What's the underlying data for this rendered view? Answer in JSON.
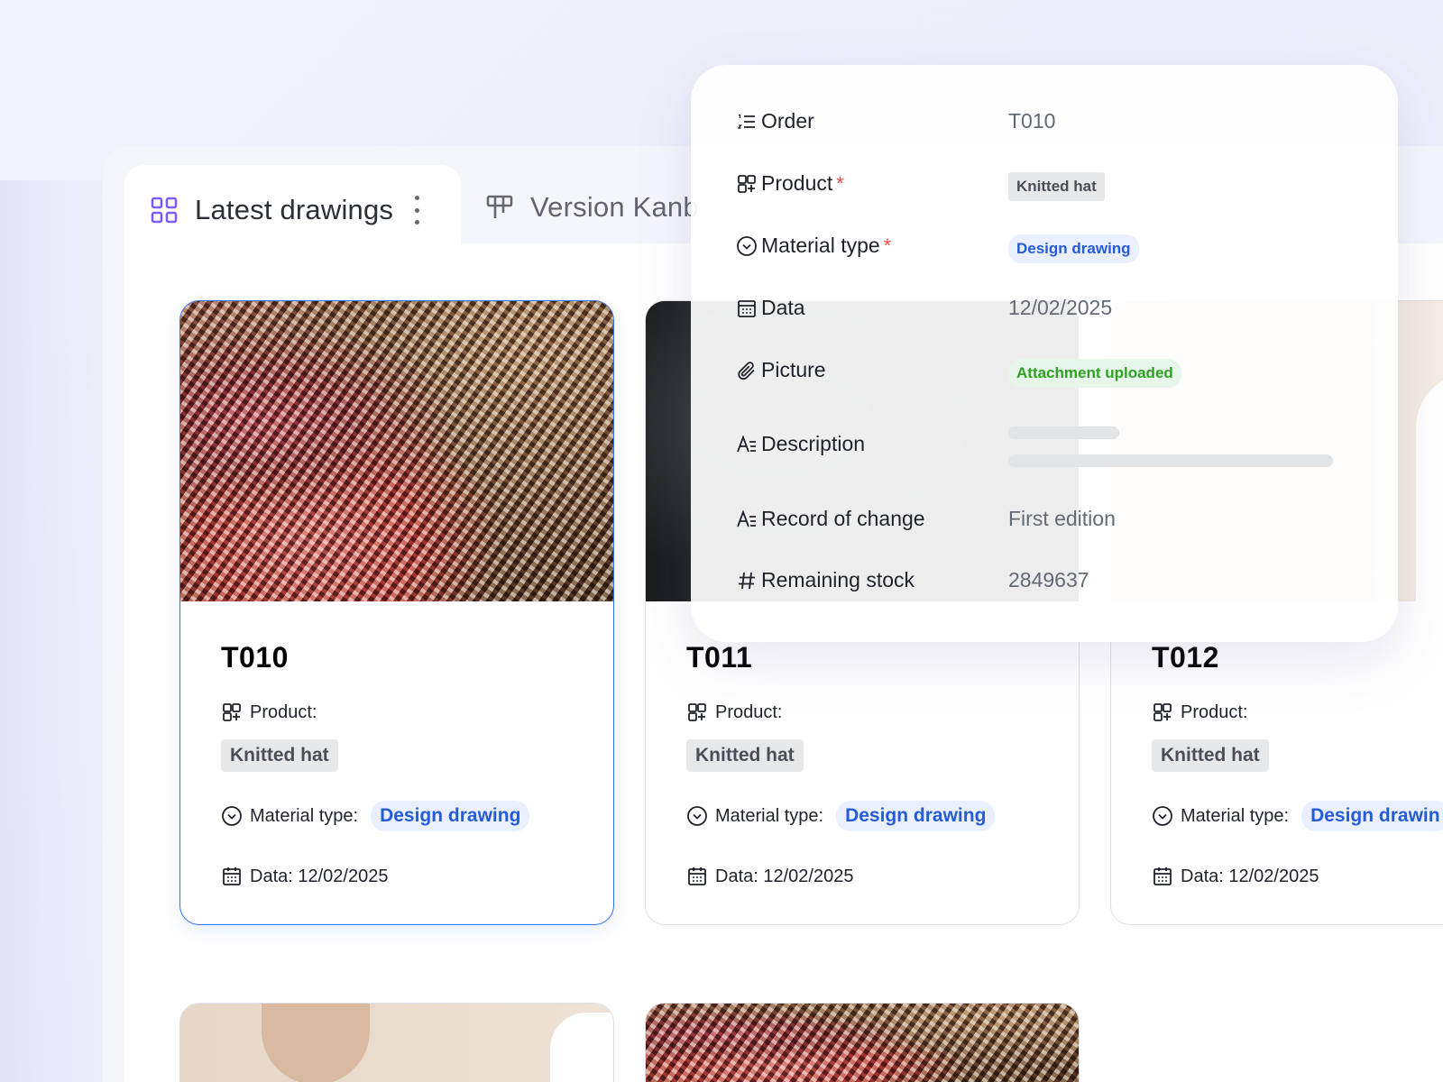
{
  "tabs": [
    {
      "label": "Latest drawings",
      "icon": "grid-icon",
      "active": true
    },
    {
      "label": "Version Kanb",
      "icon": "kanban-icon",
      "active": false
    }
  ],
  "cards": [
    {
      "title": "T010",
      "product_label": "Product:",
      "product_value": "Knitted hat",
      "material_label": "Material type:",
      "material_value": "Design drawing",
      "date_text": "Data: 12/02/2025"
    },
    {
      "title": "T011",
      "product_label": "Product:",
      "product_value": "Knitted hat",
      "material_label": "Material type:",
      "material_value": "Design drawing",
      "date_text": "Data: 12/02/2025"
    },
    {
      "title": "T012",
      "product_label": "Product:",
      "product_value": "Knitted hat",
      "material_label": "Material type:",
      "material_value": "Design drawin",
      "date_text": "Data: 12/02/2025"
    }
  ],
  "detail": {
    "order_label": "Order",
    "order_value": "T010",
    "product_label": "Product",
    "product_value": "Knitted hat",
    "material_label": "Material type",
    "material_value": "Design drawing",
    "date_label": "Data",
    "date_value": "12/02/2025",
    "picture_label": "Picture",
    "picture_value": "Attachment uploaded",
    "description_label": "Description",
    "record_label": "Record of change",
    "record_value": "First edition",
    "stock_label": "Remaining stock",
    "stock_value": "2849637",
    "required_mark": "*"
  },
  "colors": {
    "accent": "#3370ff",
    "tag_blue_text": "#245bdb",
    "tag_green_text": "#2ea121",
    "required": "#f54a45"
  }
}
